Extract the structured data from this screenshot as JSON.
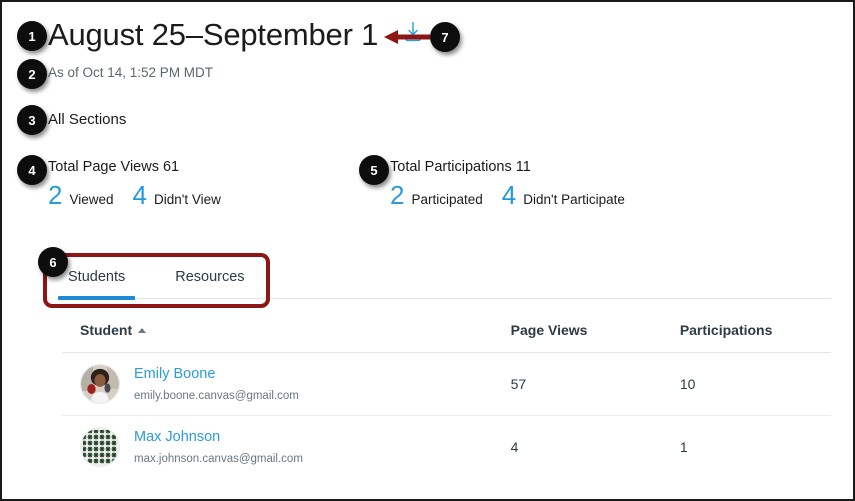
{
  "header": {
    "title": "August 25–September 1",
    "as_of": "As of Oct 14, 1:52 PM MDT",
    "sections": "All Sections",
    "download_icon": "download-icon"
  },
  "callouts": [
    {
      "number": "1",
      "target": "page-title"
    },
    {
      "number": "2",
      "target": "as-of-timestamp"
    },
    {
      "number": "3",
      "target": "all-sections"
    },
    {
      "number": "4",
      "target": "total-page-views"
    },
    {
      "number": "5",
      "target": "total-participations"
    },
    {
      "number": "6",
      "target": "tabs"
    },
    {
      "number": "7",
      "target": "download-button"
    }
  ],
  "stats": {
    "page_views": {
      "total_label": "Total Page Views 61",
      "breakdown": [
        {
          "value": "2",
          "label": "Viewed"
        },
        {
          "value": "4",
          "label": "Didn't View"
        }
      ]
    },
    "participations": {
      "total_label": "Total Participations 11",
      "breakdown": [
        {
          "value": "2",
          "label": "Participated"
        },
        {
          "value": "4",
          "label": "Didn't Participate"
        }
      ]
    }
  },
  "tabs": [
    {
      "label": "Students",
      "active": true
    },
    {
      "label": "Resources",
      "active": false
    }
  ],
  "table": {
    "columns": {
      "student": "Student",
      "page_views": "Page Views",
      "participations": "Participations"
    },
    "sort": "ascending",
    "rows": [
      {
        "name": "Emily Boone",
        "email": "emily.boone.canvas@gmail.com",
        "page_views": "57",
        "participations": "10",
        "avatar": "photo-avatar"
      },
      {
        "name": "Max Johnson",
        "email": "max.johnson.canvas@gmail.com",
        "page_views": "4",
        "participations": "1",
        "avatar": "identicon-avatar"
      }
    ]
  },
  "colors": {
    "link": "#2b9cdb",
    "tab_underline": "#1c8ad6",
    "callout_red": "#8c1515",
    "badge_bg": "#0d0d0d",
    "muted_text": "#6b7780"
  }
}
